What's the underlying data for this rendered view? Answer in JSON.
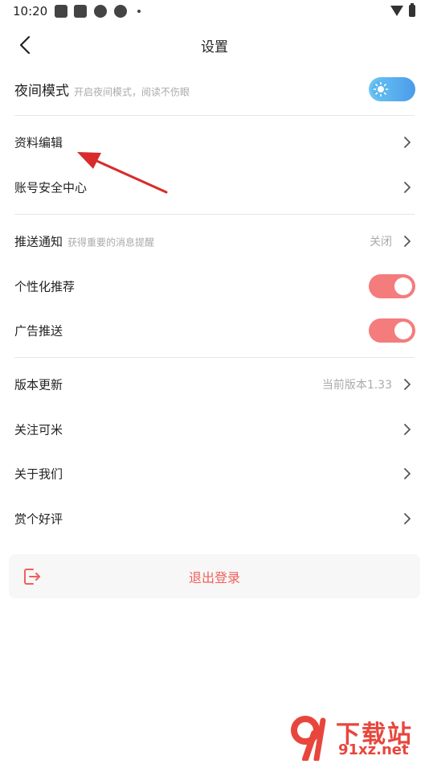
{
  "status_bar": {
    "time": "10:20"
  },
  "header": {
    "title": "设置"
  },
  "night_mode": {
    "label": "夜间模式",
    "hint": "开启夜间模式，阅读不伤眼"
  },
  "profile_edit": {
    "label": "资料编辑"
  },
  "account_security": {
    "label": "账号安全中心"
  },
  "push_notify": {
    "label": "推送通知",
    "hint": "获得重要的消息提醒",
    "value": "关闭"
  },
  "personalized": {
    "label": "个性化推荐",
    "enabled": true
  },
  "ad_push": {
    "label": "广告推送",
    "enabled": true
  },
  "version": {
    "label": "版本更新",
    "value": "当前版本1.33"
  },
  "follow": {
    "label": "关注可米"
  },
  "about": {
    "label": "关于我们"
  },
  "rate": {
    "label": "赏个好评"
  },
  "logout": {
    "label": "退出登录"
  },
  "watermark": {
    "top": "下载站",
    "bottom": "91xz.net"
  },
  "colors": {
    "accent": "#f0605a",
    "toggle_on": "#f47c7c",
    "divider": "#e6e6e6",
    "annotation_arrow": "#d92b2b"
  }
}
